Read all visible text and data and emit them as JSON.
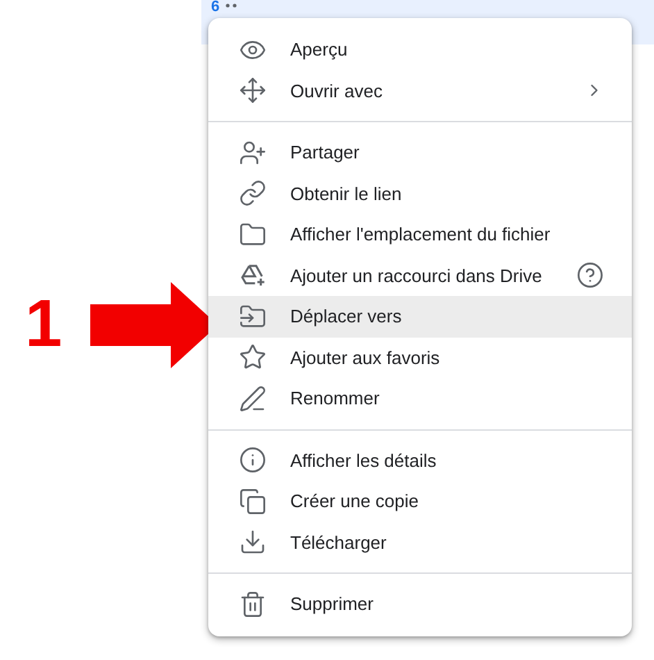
{
  "header": {
    "count": "6"
  },
  "annotation": {
    "label": "1"
  },
  "menu": {
    "groups": [
      {
        "items": [
          {
            "label": "Aperçu",
            "selected": false
          },
          {
            "label": "Ouvrir avec",
            "selected": false,
            "submenu": true
          }
        ]
      },
      {
        "items": [
          {
            "label": "Partager",
            "selected": false
          },
          {
            "label": "Obtenir le lien",
            "selected": false
          },
          {
            "label": "Afficher l'emplacement du fichier",
            "selected": false
          },
          {
            "label": "Ajouter un raccourci dans Drive",
            "selected": false,
            "help": true
          },
          {
            "label": "Déplacer vers",
            "selected": true
          },
          {
            "label": "Ajouter aux favoris",
            "selected": false
          },
          {
            "label": "Renommer",
            "selected": false
          }
        ]
      },
      {
        "items": [
          {
            "label": "Afficher les détails",
            "selected": false
          },
          {
            "label": "Créer une copie",
            "selected": false
          },
          {
            "label": "Télécharger",
            "selected": false
          }
        ]
      },
      {
        "items": [
          {
            "label": "Supprimer",
            "selected": false
          }
        ]
      }
    ]
  }
}
